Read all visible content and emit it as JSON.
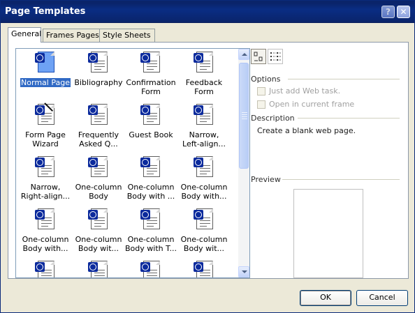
{
  "window": {
    "title": "Page Templates"
  },
  "tabs": [
    {
      "label": "General",
      "active": true
    },
    {
      "label": "Frames Pages",
      "active": false
    },
    {
      "label": "Style Sheets",
      "active": false
    }
  ],
  "templates": [
    {
      "label": "Normal Page",
      "selected": true,
      "icon": "blank-page-icon"
    },
    {
      "label": "Bibliography",
      "icon": "web-page-icon"
    },
    {
      "label": "Confirmation\nForm",
      "icon": "web-page-icon"
    },
    {
      "label": "Feedback\nForm",
      "icon": "web-page-icon"
    },
    {
      "label": "Form Page\nWizard",
      "icon": "wizard-page-icon"
    },
    {
      "label": "Frequently\nAsked Q...",
      "icon": "web-page-icon"
    },
    {
      "label": "Guest Book",
      "icon": "web-page-icon"
    },
    {
      "label": "Narrow,\nLeft-align...",
      "icon": "web-page-icon"
    },
    {
      "label": "Narrow,\nRight-align...",
      "icon": "web-page-icon"
    },
    {
      "label": "One-column\nBody",
      "icon": "web-page-icon"
    },
    {
      "label": "One-column\nBody with ...",
      "icon": "web-page-icon"
    },
    {
      "label": "One-column\nBody with...",
      "icon": "web-page-icon"
    },
    {
      "label": "One-column\nBody with...",
      "icon": "web-page-icon"
    },
    {
      "label": "One-column\nBody wit...",
      "icon": "web-page-icon"
    },
    {
      "label": "One-column\nBody with T...",
      "icon": "web-page-icon"
    },
    {
      "label": "One-column\nBody wit...",
      "icon": "web-page-icon"
    },
    {
      "label": "",
      "icon": "web-page-icon"
    },
    {
      "label": "",
      "icon": "web-page-icon"
    },
    {
      "label": "",
      "icon": "web-page-icon"
    },
    {
      "label": "",
      "icon": "web-page-icon"
    }
  ],
  "options": {
    "heading": "Options",
    "just_add_web_task": "Just add Web task.",
    "open_in_current_frame": "Open in current frame"
  },
  "description": {
    "heading": "Description",
    "text": "Create a blank web page."
  },
  "preview": {
    "heading": "Preview"
  },
  "buttons": {
    "ok": "OK",
    "cancel": "Cancel"
  },
  "colors": {
    "titlebar": "#0a246a",
    "selection": "#316ac5",
    "dialog_bg": "#ece9d8"
  }
}
